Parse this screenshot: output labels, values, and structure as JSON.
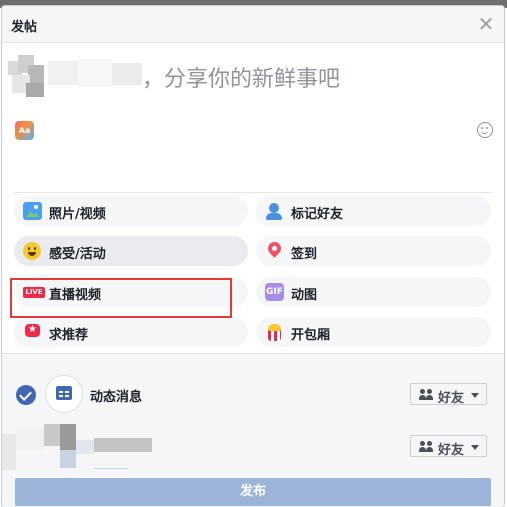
{
  "dialog": {
    "title": "发帖",
    "close_icon": "close-icon"
  },
  "composer": {
    "prompt": "，分享你的新鲜事吧",
    "left_icon": "text-style-icon",
    "left_icon_text": "Aa",
    "right_icon": "emoji-icon"
  },
  "actions": [
    {
      "label": "照片/视频",
      "icon": "photo-icon"
    },
    {
      "label": "标记好友",
      "icon": "tag-friends-icon"
    },
    {
      "label": "感受/活动",
      "icon": "feeling-icon"
    },
    {
      "label": "签到",
      "icon": "check-in-icon"
    },
    {
      "label": "直播视频",
      "icon": "live-video-icon",
      "icon_text": "LIVE"
    },
    {
      "label": "动图",
      "icon": "gif-icon",
      "icon_text": "GIF"
    },
    {
      "label": "求推荐",
      "icon": "recommendation-icon"
    },
    {
      "label": "开包厢",
      "icon": "watch-party-icon"
    }
  ],
  "footer": {
    "news_feed_label": "动态消息",
    "audience_1": "好友",
    "audience_2": "好友",
    "publish_label": "发布"
  },
  "colors": {
    "accent": "#4267b2",
    "highlight": "#e53935",
    "publish_disabled": "#9cb4d8"
  }
}
